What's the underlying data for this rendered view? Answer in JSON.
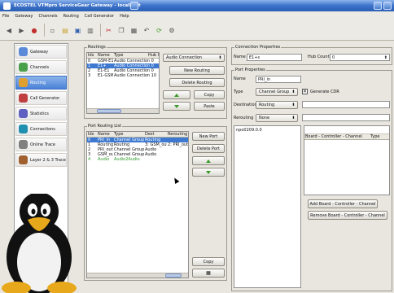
{
  "window": {
    "title": "ECOSTEL VTMpro ServiceGear Gateway - localhost"
  },
  "menu": [
    "File",
    "Gateway",
    "Channels",
    "Routing",
    "Call Generator",
    "Help"
  ],
  "toolbar_icons": [
    "back-icon",
    "forward-icon",
    "stop-icon",
    "new-icon",
    "open-icon",
    "save-icon",
    "print-icon",
    "cut-icon",
    "copy-icon",
    "paste-icon",
    "undo-icon",
    "refresh-icon",
    "settings-icon"
  ],
  "sidebar": [
    {
      "label": "Gateway",
      "icon": "gateway-icon",
      "color": "#5a8ad8"
    },
    {
      "label": "Channels",
      "icon": "channels-icon",
      "color": "#4aa04a"
    },
    {
      "label": "Routing",
      "icon": "routing-icon",
      "color": "#e0a030"
    },
    {
      "label": "Call Generator",
      "icon": "call-generator-icon",
      "color": "#c04040"
    },
    {
      "label": "Statistics",
      "icon": "statistics-icon",
      "color": "#6060c0"
    },
    {
      "label": "Connections",
      "icon": "connections-icon",
      "color": "#2090b0"
    },
    {
      "label": "Online Trace",
      "icon": "online-trace-icon",
      "color": "#808080"
    },
    {
      "label": "Layer 2 & 3 Trace",
      "icon": "layer-trace-icon",
      "color": "#a06030"
    }
  ],
  "routings": {
    "title": "Routings",
    "columns": [
      "Idx",
      "Name",
      "Type",
      "Hub C"
    ],
    "rows": [
      [
        "0",
        "GSM-E1",
        "Audio Connection 0",
        ""
      ],
      [
        "1",
        "E1+",
        "Audio Connection 0",
        ""
      ],
      [
        "2",
        "E1-E1",
        "Audio Connection 0",
        ""
      ],
      [
        "3",
        "E1-GSM",
        "Audio Connection 10",
        ""
      ]
    ],
    "selected_row": 1,
    "type_combo": "Audio Connection",
    "new_button": "New Routing",
    "delete_button": "Delete Routing",
    "copy_button": "Copy",
    "paste_button": "Paste"
  },
  "port_routing": {
    "title": "Port Routing List",
    "columns": [
      "Idx",
      "Name",
      "Type",
      "Dest",
      "Rerouting"
    ],
    "rows": [
      [
        "0",
        "PRI_in",
        "Channel Group 1",
        "Routing",
        ""
      ],
      [
        "1",
        "Routing",
        "Routing",
        "3: GSM_out",
        "2: PRI_out"
      ],
      [
        "2",
        "PRI_out",
        "Channel Group 4",
        "Audio",
        ""
      ],
      [
        "3",
        "GSM_out",
        "Channel Group 4",
        "Audio",
        ""
      ],
      [
        "4",
        "Audio",
        "Audio2Audio",
        "",
        ""
      ]
    ],
    "selected_row": 0,
    "green_row": 4,
    "new_button": "New Port",
    "delete_button": "Delete Port",
    "copy_button": "Copy"
  },
  "connection_properties": {
    "title": "Connection Properties",
    "name_label": "Name",
    "name_value": "E1+s",
    "hub_count_label": "Hub Count",
    "hub_count_value": "0"
  },
  "port_properties": {
    "title": "Port Properties",
    "name_label": "Name",
    "name_value": "PRI_in",
    "type_label": "Type",
    "type_value": "Channel Group",
    "generate_cdr_label": "Generate CDR",
    "destination_label": "Destination",
    "destination_value": "Routing",
    "rerouting_label": "Rerouting",
    "rerouting_value": "None",
    "text_area_value": "npo0209.0.0",
    "board_columns": [
      "Board - Controller - Channel",
      "Type"
    ],
    "add_button": "Add Board - Controller - Channel",
    "remove_button": "Remove Board - Controller - Channel"
  }
}
